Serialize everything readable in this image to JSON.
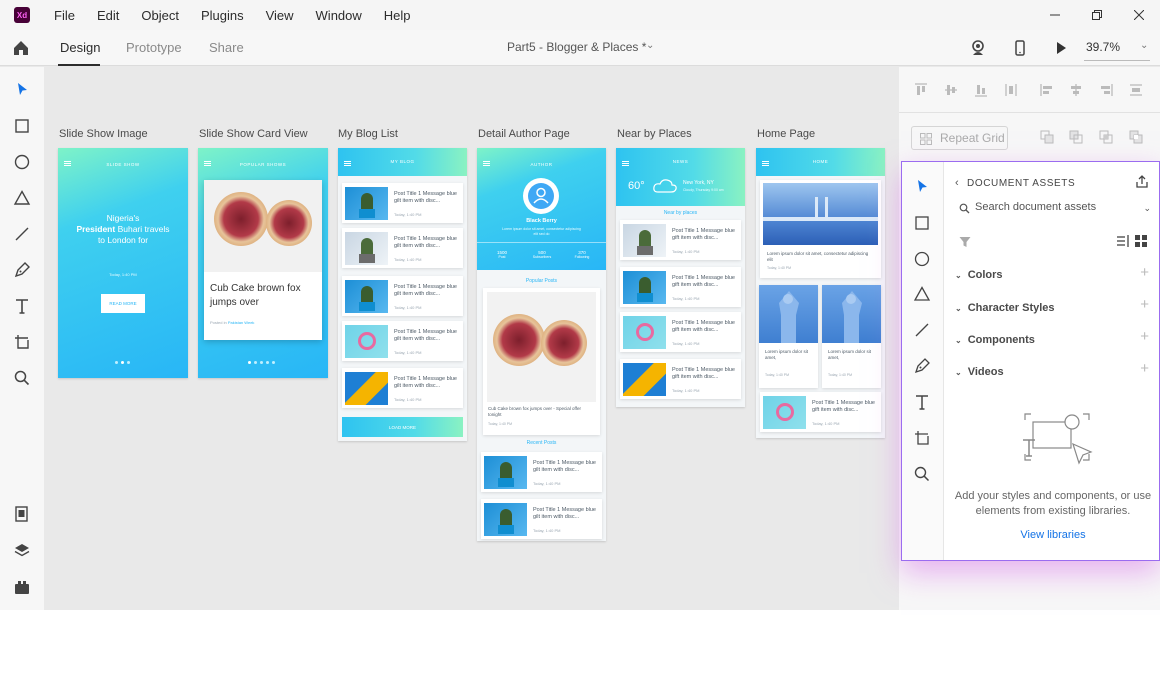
{
  "app": {
    "logo": "Xd",
    "menu": [
      "File",
      "Edit",
      "Object",
      "Plugins",
      "View",
      "Window",
      "Help"
    ],
    "window_controls": [
      "minimize-icon",
      "restore-icon",
      "close-icon"
    ]
  },
  "tabs": {
    "items": [
      "Design",
      "Prototype",
      "Share"
    ],
    "active": "Design",
    "document_title": "Part5 - Blogger & Places *",
    "zoom": "39.7%"
  },
  "left_toolbar": [
    "select-icon",
    "rectangle-icon",
    "ellipse-icon",
    "triangle-icon",
    "line-icon",
    "pen-icon",
    "text-icon",
    "artboard-icon",
    "zoom-icon",
    "assets-icon",
    "layers-icon",
    "plugins-icon"
  ],
  "artboards": [
    {
      "label": "Slide Show Image",
      "header": "SLIDE SHOW",
      "headline_pre": "Nigeria's",
      "headline_bold": "President",
      "headline_post": "Buhari travels to London for",
      "date": "Today, 1:40 PM",
      "button": "READ MORE"
    },
    {
      "label": "Slide Show Card View",
      "header": "POPULAR SHOWS",
      "card_title": "Cub Cake brown fox jumps over",
      "card_meta_pre": "Posted in",
      "card_meta_link": "Pakistan Week"
    },
    {
      "label": "My Blog List",
      "header": "MY BLOG",
      "post_title": "Post Title 1 Message blue gilt item with disc...",
      "post_date": "Today, 1:40 PM",
      "load_more": "LOAD MORE"
    },
    {
      "label": "Detail Author Page",
      "header": "AUTHOR",
      "author_name": "Black Berry",
      "author_bio": "Lorem ipsum dolor sit amet, consectetur adipiscing elit sed do",
      "stats": [
        {
          "value": "1500",
          "label": "Post"
        },
        {
          "value": "500",
          "label": "Subscribers"
        },
        {
          "value": "370",
          "label": "Following"
        }
      ],
      "popular_posts": "Popular Posts",
      "popular_caption": "Cub Cake brown fox jumps over - Special offer tonight",
      "popular_date": "Today, 1:40 PM",
      "recent_posts": "Recent Posts",
      "post_title": "Post Title 1 Message blue gilt item with disc...",
      "post_date": "Today, 1:40 PM"
    },
    {
      "label": "Near by Places",
      "header": "NEWS",
      "temperature": "60°",
      "city": "New York, NY",
      "weather": "Cloudy, Thursday 9:00 am",
      "nearby": "Near by places",
      "post_title": "Post Title 1 Message blue gift item with disc...",
      "post_date": "Today, 1:40 PM"
    },
    {
      "label": "Home Page",
      "header": "HOME",
      "hero_caption": "Lorem ipsum dolor sit amet, consectetur adipiscing elit",
      "hero_date": "Today, 1:40 PM",
      "grid_caption": "Lorem ipsum dolor sit amet,",
      "grid_date": "Today, 1:40 PM",
      "post_title": "Post Title 1 Message blue gift item with disc...",
      "post_date": "Today, 1:40 PM"
    }
  ],
  "right_panel": {
    "repeat_grid": "Repeat Grid",
    "align_icons": [
      "align-top-icon",
      "align-middle-icon",
      "align-bottom-icon",
      "distribute-vertical-icon",
      "align-left-icon",
      "align-center-icon",
      "align-right-icon",
      "distribute-horizontal-icon"
    ],
    "boolean_icons": [
      "add-icon",
      "subtract-icon",
      "intersect-icon",
      "exclude-icon"
    ]
  },
  "assets": {
    "title": "DOCUMENT ASSETS",
    "search_placeholder": "Search document assets",
    "sections": [
      "Colors",
      "Character Styles",
      "Components",
      "Videos"
    ],
    "empty_text": "Add your styles and components, or use elements from existing libraries.",
    "view_libraries": "View libraries"
  },
  "colors": {
    "accent": "#1473e6",
    "panel_border": "#9b6cf0",
    "gradient_start": "#8af2c2",
    "gradient_end": "#28b6f6"
  }
}
